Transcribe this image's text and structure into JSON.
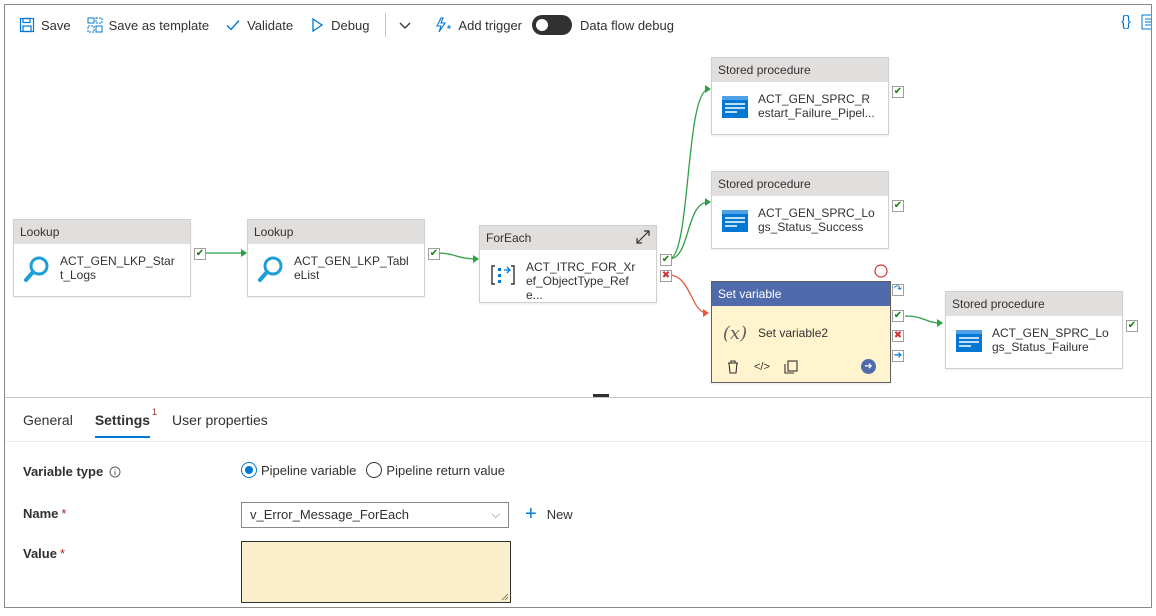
{
  "toolbar": {
    "save": "Save",
    "save_template": "Save as template",
    "validate": "Validate",
    "debug": "Debug",
    "add_trigger": "Add trigger",
    "dataflow_debug": "Data flow debug",
    "code_glyph": "{}"
  },
  "nodes": {
    "lookup1": {
      "type": "Lookup",
      "name": "ACT_GEN_LKP_Start_Logs"
    },
    "lookup2": {
      "type": "Lookup",
      "name": "ACT_GEN_LKP_TableList"
    },
    "foreach": {
      "type": "ForEach",
      "name": "ACT_ITRC_FOR_Xref_ObjectType_Refe..."
    },
    "sp1": {
      "type": "Stored procedure",
      "name": "ACT_GEN_SPRC_Restart_Failure_Pipel..."
    },
    "sp2": {
      "type": "Stored procedure",
      "name": "ACT_GEN_SPRC_Logs_Status_Success"
    },
    "setvar": {
      "type": "Set variable",
      "name": "Set variable2",
      "code_glyph": "</>"
    },
    "sp3": {
      "type": "Stored procedure",
      "name": "ACT_GEN_SPRC_Logs_Status_Failure"
    }
  },
  "panel": {
    "tabs": [
      {
        "label": "General"
      },
      {
        "label": "Settings",
        "badge": "1"
      },
      {
        "label": "User properties"
      }
    ],
    "variable_type_label": "Variable type",
    "radio_pipeline_variable": "Pipeline variable",
    "radio_pipeline_return": "Pipeline return value",
    "name_label": "Name",
    "name_value": "v_Error_Message_ForEach",
    "new_button": "New",
    "value_label": "Value",
    "required_mark": "*"
  },
  "colors": {
    "accent": "#0078d4",
    "selected_header": "#4f6bab",
    "selected_fill": "#fff4ce",
    "success": "#107c10",
    "failure": "#d13438",
    "success_link": "#2ea043",
    "failure_link": "#e8583a"
  }
}
